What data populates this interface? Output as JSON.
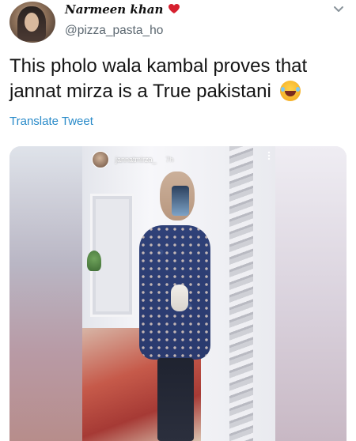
{
  "author": {
    "display_name": "Narmeen khan",
    "handle": "@pizza_pasta_ho",
    "name_emoji": "heart-icon"
  },
  "tweet": {
    "text": "This pholo wala kambal proves that jannat mirza is a True pakistani",
    "emoji": "laughing-with-tears-emoji",
    "translate_label": "Translate Tweet"
  },
  "media": {
    "story_username": "jannatmirza_",
    "story_time": "7h"
  },
  "colors": {
    "link": "#2a8bc9",
    "handle": "#5b6770",
    "heart": "#d6202f"
  }
}
